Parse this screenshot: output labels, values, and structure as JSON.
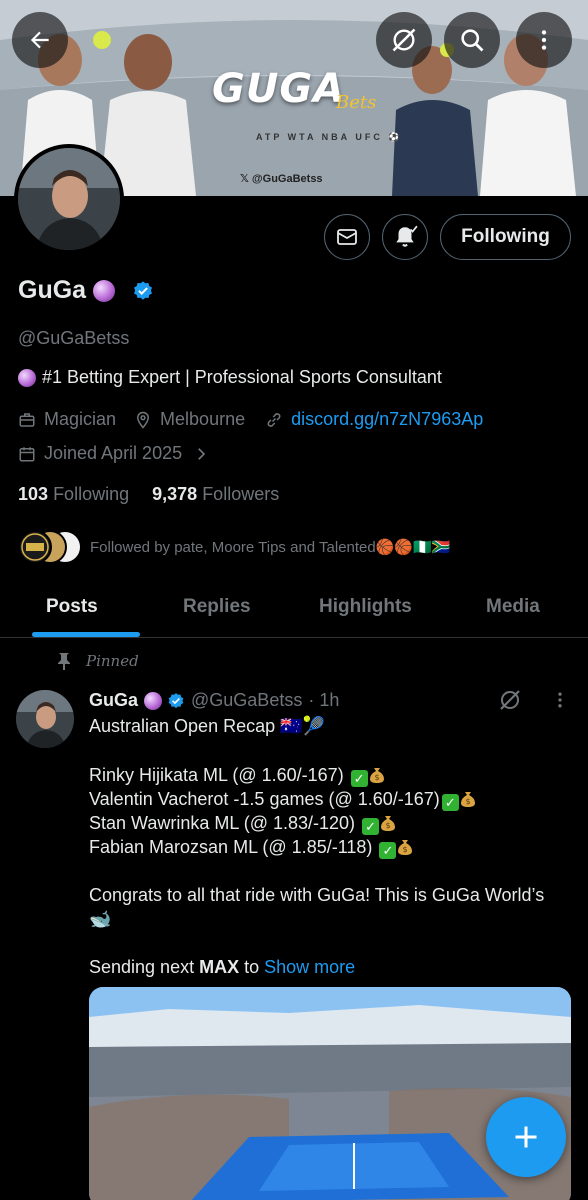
{
  "banner": {
    "brand": "GUGA",
    "brand_sub": "Bets",
    "leagues": "ATP WTA NBA UFC ⚽",
    "x_handle": "𝕏 @GuGaBetss"
  },
  "profile": {
    "name": "GuGa",
    "handle": "@GuGaBetss",
    "bio": "#1 Betting Expert | Professional Sports Consultant",
    "occupation": "Magician",
    "location": "Melbourne",
    "website": "discord.gg/n7zN7963Ap",
    "joined": "Joined April 2025",
    "following_count": "103",
    "following_label": "Following",
    "followers_count": "9,378",
    "followers_label": "Followers",
    "followed_by": "Followed by pate, Moore Tips and Talented🏀🏀🇳🇬🇿🇦",
    "follow_button_label": "Following"
  },
  "tabs": [
    {
      "label": "Posts"
    },
    {
      "label": "Replies"
    },
    {
      "label": "Highlights"
    },
    {
      "label": "Media"
    }
  ],
  "post": {
    "pinned_label": "Pinned",
    "author": "GuGa",
    "handle": "@GuGaBetss",
    "time": "· 1h",
    "title": "Australian Open Recap 🇦🇺🎾",
    "bets": [
      "Rinky Hijikata ML (@ 1.60/-167)",
      "Valentin Vacherot -1.5 games (@ 1.60/-167)",
      "Stan Wawrinka ML (@ 1.83/-120)",
      "Fabian Marozsan ML (@ 1.85/-118)"
    ],
    "congrats": " Congrats to all that ride with GuGa! This is GuGa World’s",
    "whale": "🐋",
    "sending_prefix": "Sending next ",
    "sending_bold": "MAX",
    "sending_suffix": " to ",
    "show_more": "Show more"
  },
  "colors": {
    "accent": "#1d9bf0",
    "background": "#000000",
    "text_primary": "#e7e9ea",
    "text_secondary": "#71767b",
    "border": "#2f3336"
  }
}
